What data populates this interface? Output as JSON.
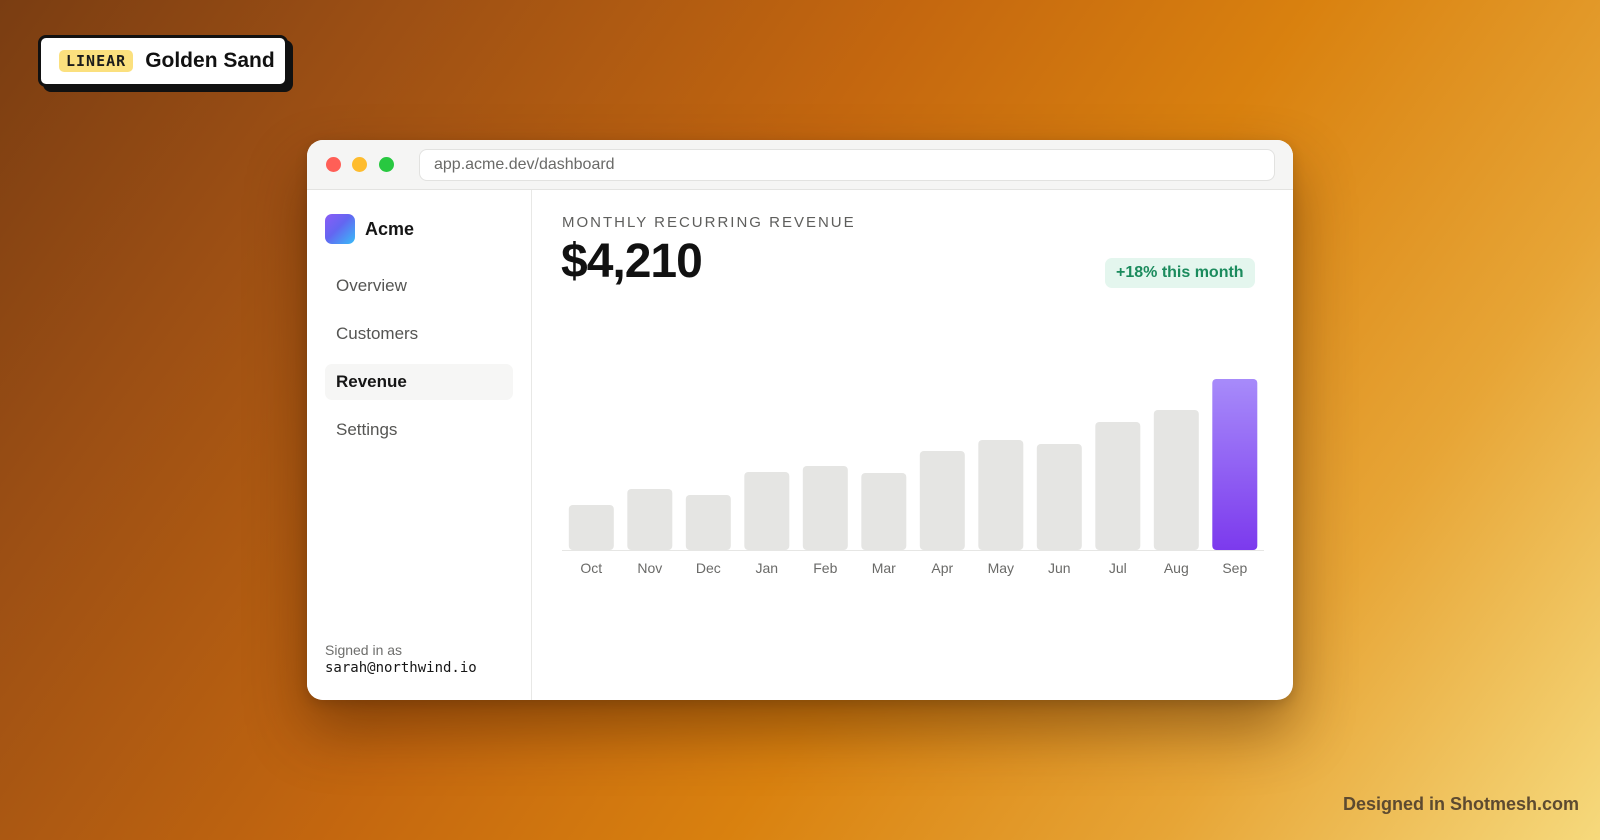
{
  "tag": {
    "badge": "LINEAR",
    "title": "Golden Sand"
  },
  "window": {
    "url": "app.acme.dev/dashboard"
  },
  "sidebar": {
    "brand": "Acme",
    "items": [
      {
        "label": "Overview",
        "active": false
      },
      {
        "label": "Customers",
        "active": false
      },
      {
        "label": "Revenue",
        "active": true
      },
      {
        "label": "Settings",
        "active": false
      }
    ],
    "signed_in_label": "Signed in as",
    "signed_in_email": "sarah@northwind.io"
  },
  "main": {
    "kicker": "MONTHLY RECURRING REVENUE",
    "value": "$4,210",
    "delta": "+18% this month"
  },
  "chart_data": {
    "type": "bar",
    "categories": [
      "Oct",
      "Nov",
      "Dec",
      "Jan",
      "Feb",
      "Mar",
      "Apr",
      "May",
      "Jun",
      "Jul",
      "Aug",
      "Sep"
    ],
    "values": [
      45,
      61,
      55,
      78,
      84,
      77,
      99,
      110,
      106,
      128,
      140,
      171
    ],
    "highlight_index": 11,
    "bar_color": "#e5e5e3",
    "highlight_color": "#8b5cf6",
    "ylim": [
      0,
      180
    ],
    "grid": false
  },
  "footer": {
    "credit": "Designed in Shotmesh.com"
  },
  "colors": {
    "accent_green": "#1b8b5d",
    "accent_purple": "#8b5cf6"
  }
}
